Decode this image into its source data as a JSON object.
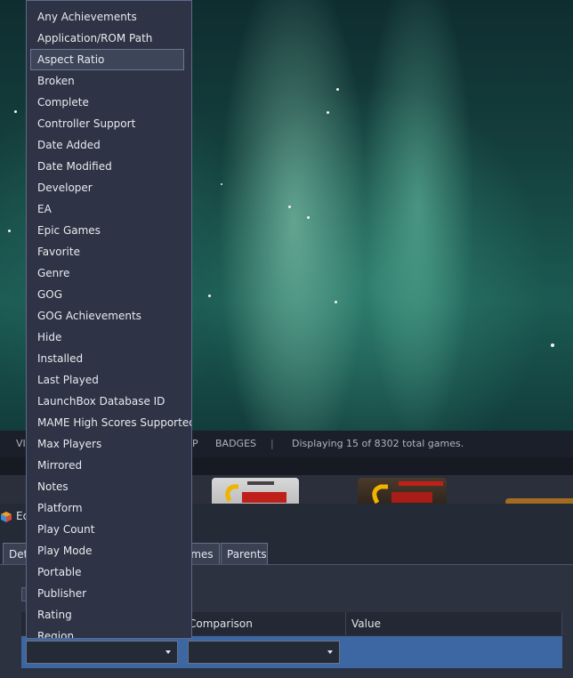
{
  "toolbar": {
    "item1": "VI",
    "item2": "P",
    "badges": "BADGES",
    "separator": "|",
    "status": "Displaying 15 of 8302 total games."
  },
  "window": {
    "title": "Ed"
  },
  "tabs": [
    "Det",
    "ames",
    "Parents"
  ],
  "grid": {
    "columns": {
      "comparison": "Comparison",
      "value": "Value"
    }
  },
  "dropdown": {
    "selected": "Aspect Ratio",
    "items": [
      "Any Achievements",
      "Application/ROM Path",
      "Aspect Ratio",
      "Broken",
      "Complete",
      "Controller Support",
      "Date Added",
      "Date Modified",
      "Developer",
      "EA",
      "Epic Games",
      "Favorite",
      "Genre",
      "GOG",
      "GOG Achievements",
      "Hide",
      "Installed",
      "Last Played",
      "LaunchBox Database ID",
      "MAME High Scores Supported",
      "Max Players",
      "Mirrored",
      "Notes",
      "Platform",
      "Play Count",
      "Play Mode",
      "Portable",
      "Publisher",
      "Rating",
      "Region"
    ]
  },
  "colors": {
    "dropdown_bg": "#2e3445",
    "selected_row": "#3c67a3",
    "window_bg": "#242a36"
  }
}
